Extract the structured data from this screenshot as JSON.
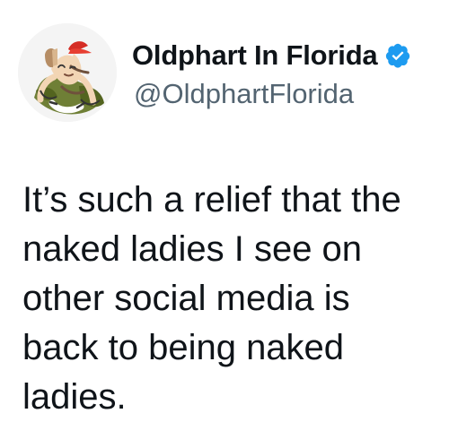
{
  "author": {
    "display_name": "Oldphart In Florida",
    "handle": "@OldphartFlorida",
    "verified": true,
    "verified_color": "#1d9bf0",
    "avatar_icon": "cartoon-old-man-in-recliner-avatar"
  },
  "tweet": {
    "lines": [
      "It’s such a relief that the",
      "naked ladies I see on",
      "other social media is",
      "back to being naked",
      "ladies."
    ]
  },
  "colors": {
    "text": "#0f1419",
    "secondary_text": "#536471",
    "background": "#ffffff"
  }
}
